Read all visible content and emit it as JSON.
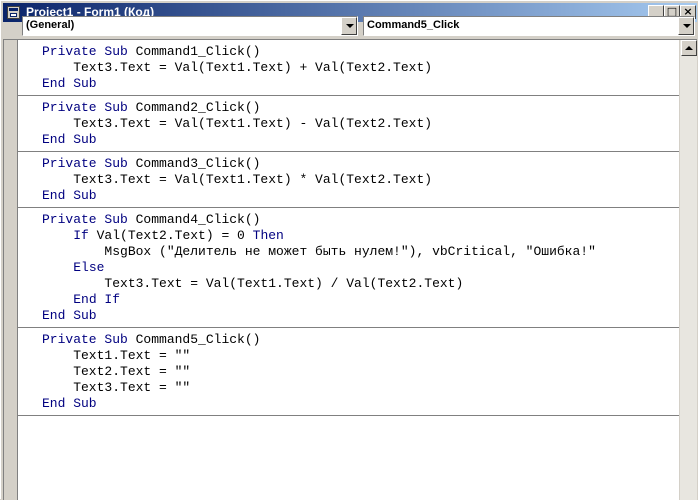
{
  "window": {
    "title": "Project1 - Form1 (Код)",
    "minimize_label": "_",
    "maximize_label": "□",
    "close_label": "×"
  },
  "object_combo": {
    "value": "(General)"
  },
  "procedure_combo": {
    "value": "Command5_Click"
  },
  "code": {
    "procs": [
      {
        "lines": [
          [
            {
              "t": "Private Sub",
              "k": true
            },
            {
              "t": " Command1_Click()"
            }
          ],
          [
            {
              "t": "    Text3.Text = Val(Text1.Text) + Val(Text2.Text)"
            }
          ],
          [
            {
              "t": "End Sub",
              "k": true
            }
          ]
        ]
      },
      {
        "lines": [
          [
            {
              "t": "Private Sub",
              "k": true
            },
            {
              "t": " Command2_Click()"
            }
          ],
          [
            {
              "t": "    Text3.Text = Val(Text1.Text) - Val(Text2.Text)"
            }
          ],
          [
            {
              "t": "End Sub",
              "k": true
            }
          ]
        ]
      },
      {
        "lines": [
          [
            {
              "t": "Private Sub",
              "k": true
            },
            {
              "t": " Command3_Click()"
            }
          ],
          [
            {
              "t": "    Text3.Text = Val(Text1.Text) * Val(Text2.Text)"
            }
          ],
          [
            {
              "t": "End Sub",
              "k": true
            }
          ]
        ]
      },
      {
        "lines": [
          [
            {
              "t": "Private Sub",
              "k": true
            },
            {
              "t": " Command4_Click()"
            }
          ],
          [
            {
              "t": "    "
            },
            {
              "t": "If",
              "k": true
            },
            {
              "t": " Val(Text2.Text) = 0 "
            },
            {
              "t": "Then",
              "k": true
            }
          ],
          [
            {
              "t": "        MsgBox (\"Делитель не может быть нулем!\"), vbCritical, \"Ошибка!\""
            }
          ],
          [
            {
              "t": "    "
            },
            {
              "t": "Else",
              "k": true
            }
          ],
          [
            {
              "t": "        Text3.Text = Val(Text1.Text) / Val(Text2.Text)"
            }
          ],
          [
            {
              "t": "    "
            },
            {
              "t": "End If",
              "k": true
            }
          ],
          [
            {
              "t": "End Sub",
              "k": true
            }
          ]
        ]
      },
      {
        "lines": [
          [
            {
              "t": "Private Sub",
              "k": true
            },
            {
              "t": " Command5_Click()"
            }
          ],
          [
            {
              "t": "    Text1.Text = \"\""
            }
          ],
          [
            {
              "t": "    Text2.Text = \"\""
            }
          ],
          [
            {
              "t": "    Text3.Text = \"\""
            }
          ],
          [
            {
              "t": "End Sub",
              "k": true
            }
          ]
        ]
      }
    ]
  },
  "colors": {
    "keyword": "#000080",
    "titlebar_start": "#0a246a",
    "titlebar_end": "#a6caf0"
  }
}
